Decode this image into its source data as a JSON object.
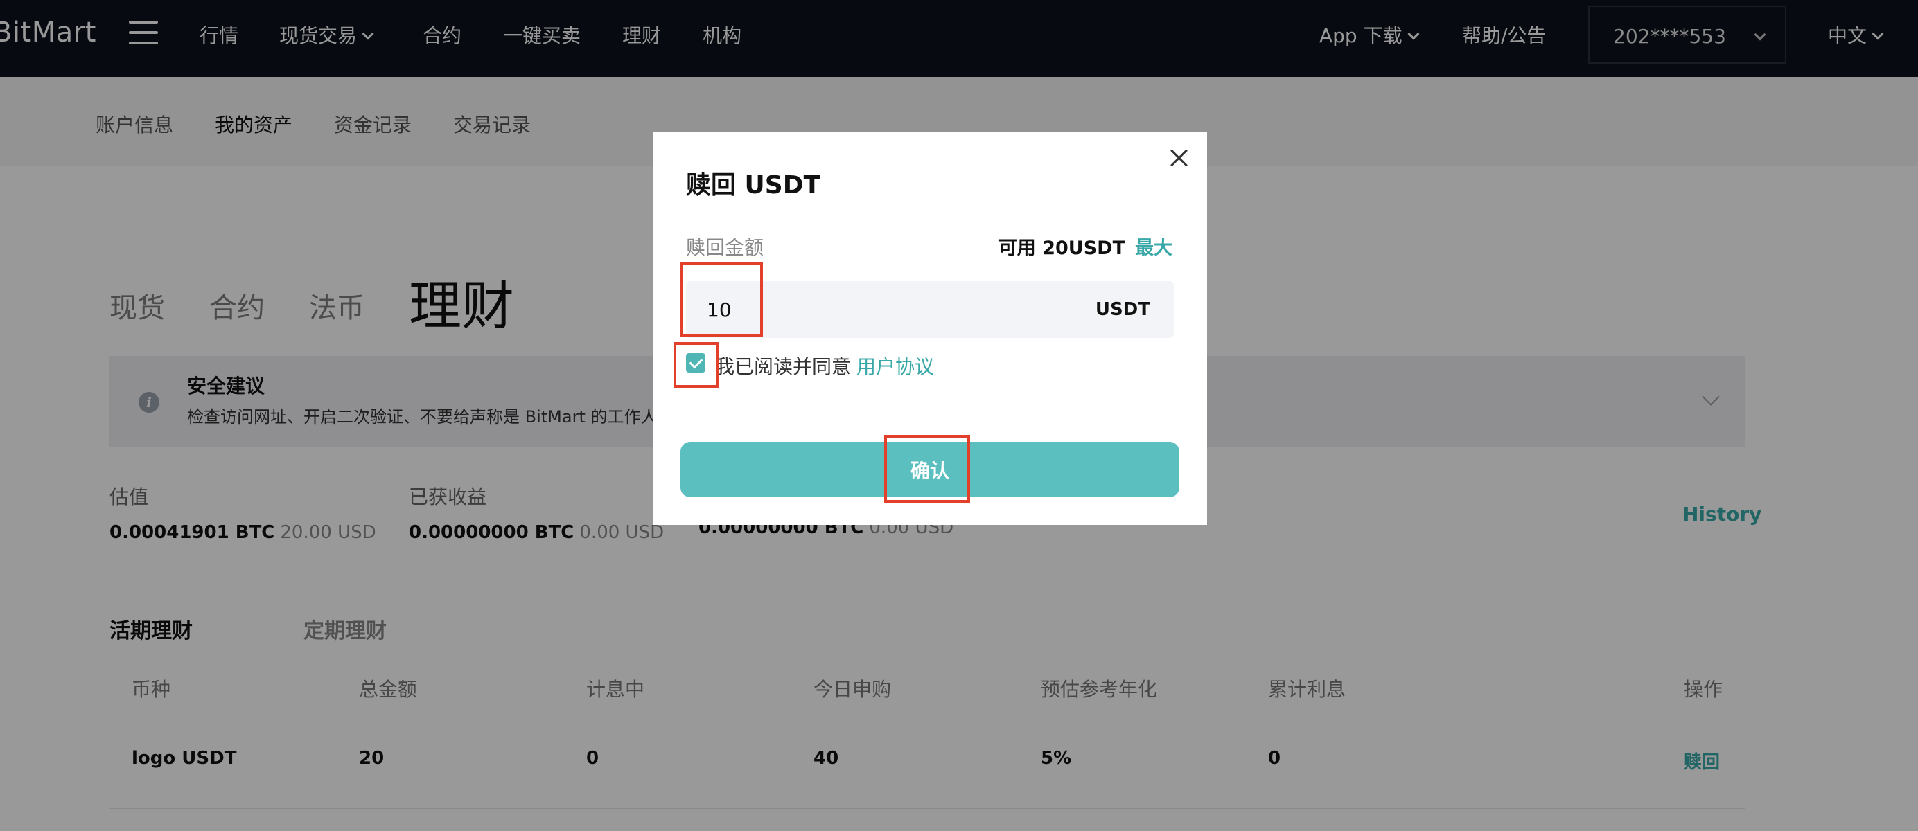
{
  "topnav": {
    "logo": "BitMart",
    "items": [
      {
        "label": "行情"
      },
      {
        "label": "现货交易"
      },
      {
        "label": "合约"
      },
      {
        "label": "一键买卖"
      },
      {
        "label": "理财"
      },
      {
        "label": "机构"
      }
    ],
    "app_download": "App 下载",
    "help": "帮助/公告",
    "user": "202****553",
    "language": "中文"
  },
  "subnav": {
    "items": [
      {
        "label": "账户信息"
      },
      {
        "label": "我的资产"
      },
      {
        "label": "资金记录"
      },
      {
        "label": "交易记录"
      }
    ]
  },
  "asset_tabs": [
    {
      "label": "现货"
    },
    {
      "label": "合约"
    },
    {
      "label": "法币"
    },
    {
      "label": "理财"
    }
  ],
  "notice": {
    "title": "安全建议",
    "text": "检查访问网址、开启二次验证、不要给声称是 BitMart 的工作人"
  },
  "stats": [
    {
      "label": "估值",
      "btc": "0.00041901 BTC",
      "usd": "20.00 USD"
    },
    {
      "label": "已获收益",
      "btc": "0.00000000 BTC",
      "usd": "0.00 USD"
    },
    {
      "label": "",
      "btc": "0.00000000 BTC",
      "usd": "0.00 USD"
    }
  ],
  "history_label": "History",
  "section_tabs": [
    {
      "label": "活期理财"
    },
    {
      "label": "定期理财"
    }
  ],
  "table": {
    "headers": [
      "币种",
      "总金额",
      "计息中",
      "今日申购",
      "预估参考年化",
      "累计利息",
      "操作"
    ],
    "rows": [
      {
        "coin": "logo USDT",
        "total": "20",
        "earning": "0",
        "today": "40",
        "apy": "5%",
        "interest": "0",
        "action": "赎回"
      }
    ]
  },
  "modal": {
    "title": "赎回 USDT",
    "amount_label": "赎回金额",
    "available": "可用 20USDT",
    "max_label": "最大",
    "input_value": "10",
    "unit": "USDT",
    "agree_text": "我已阅读并同意",
    "agree_link": "用户协议",
    "confirm": "确认"
  },
  "colors": {
    "accent": "#3aa8a8",
    "button": "#5bbfc0",
    "nav_bg": "#0d111b",
    "annotation": "#e2402b"
  }
}
